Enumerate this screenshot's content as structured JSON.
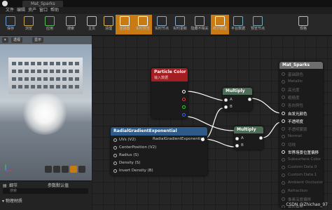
{
  "window": {
    "tab": "Mat_Sparks"
  },
  "menu": [
    "文件",
    "编辑",
    "资产",
    "窗口",
    "帮助"
  ],
  "toolbar": [
    {
      "label": "保存",
      "icon": "save-icon",
      "active": false
    },
    {
      "label": "浏览",
      "icon": "browse-icon",
      "active": false
    },
    {
      "label": "应用",
      "icon": "apply-icon",
      "active": false
    },
    {
      "label": "搜索",
      "icon": "search-icon",
      "active": false
    },
    {
      "label": "主页",
      "icon": "home-icon",
      "active": false
    },
    {
      "label": "清理",
      "icon": "clean-icon",
      "active": false
    },
    {
      "label": "连接器",
      "icon": "connector-icon",
      "active": true
    },
    {
      "label": "实时预览",
      "icon": "live-preview-icon",
      "active": true
    },
    {
      "label": "实时节点",
      "icon": "live-nodes-icon",
      "active": false
    },
    {
      "label": "实时更新",
      "icon": "live-update-icon",
      "active": false
    },
    {
      "label": "隐藏不相关",
      "icon": "hide-unrelated-icon",
      "active": false
    },
    {
      "label": "统计数据",
      "icon": "stats-icon",
      "active": true
    },
    {
      "label": "平台数据",
      "icon": "platform-stats-icon",
      "active": false
    },
    {
      "label": "预览节点",
      "icon": "preview-node-icon",
      "active": false
    },
    {
      "label": "规格",
      "icon": "settings-icon",
      "active": false
    }
  ],
  "viewport": {
    "btn_perspective": "透视",
    "btn_lit": "显示"
  },
  "details": {
    "tab_details": "细节",
    "tab_params": "参数默认值",
    "search_placeholder": "搜索",
    "category": "物理材质"
  },
  "nodes": {
    "particle_color": {
      "title": "Particle Color",
      "subtitle": "输入数据"
    },
    "radial": {
      "title": "RadialGradientExponential",
      "inputs": [
        "UVs (V2)",
        "CenterPosition (V2)",
        "Radius (S)",
        "Density (S)",
        "Invert Density (B)"
      ],
      "output": "RadialGradientExponential"
    },
    "multiply1": {
      "title": "Multiply",
      "pins": [
        "A",
        "B"
      ]
    },
    "multiply2": {
      "title": "Multiply",
      "pins": [
        "A",
        "B"
      ]
    },
    "material": {
      "title": "Mat_Sparks",
      "pins": [
        {
          "label": "基础颜色",
          "enabled": false
        },
        {
          "label": "Metallic",
          "enabled": false
        },
        {
          "label": "高光度",
          "enabled": false
        },
        {
          "label": "粗糙度",
          "enabled": false
        },
        {
          "label": "各向异性",
          "enabled": false
        },
        {
          "label": "自发光颜色",
          "enabled": true
        },
        {
          "label": "不透明度",
          "enabled": true
        },
        {
          "label": "不透明蒙版",
          "enabled": false
        },
        {
          "label": "Normal",
          "enabled": false
        },
        {
          "label": "切线",
          "enabled": false
        },
        {
          "label": "世界场景位置偏移",
          "enabled": true
        },
        {
          "label": "Subsurface Color",
          "enabled": false
        },
        {
          "label": "Custom Data 0",
          "enabled": false
        },
        {
          "label": "Custom Data 1",
          "enabled": false
        },
        {
          "label": "Ambient Occlusion",
          "enabled": false
        },
        {
          "label": "Refraction",
          "enabled": false
        },
        {
          "label": "像素深度偏移",
          "enabled": false
        },
        {
          "label": "着色模型",
          "enabled": false
        }
      ]
    }
  },
  "watermark": "CSDN @Zhichao_97"
}
